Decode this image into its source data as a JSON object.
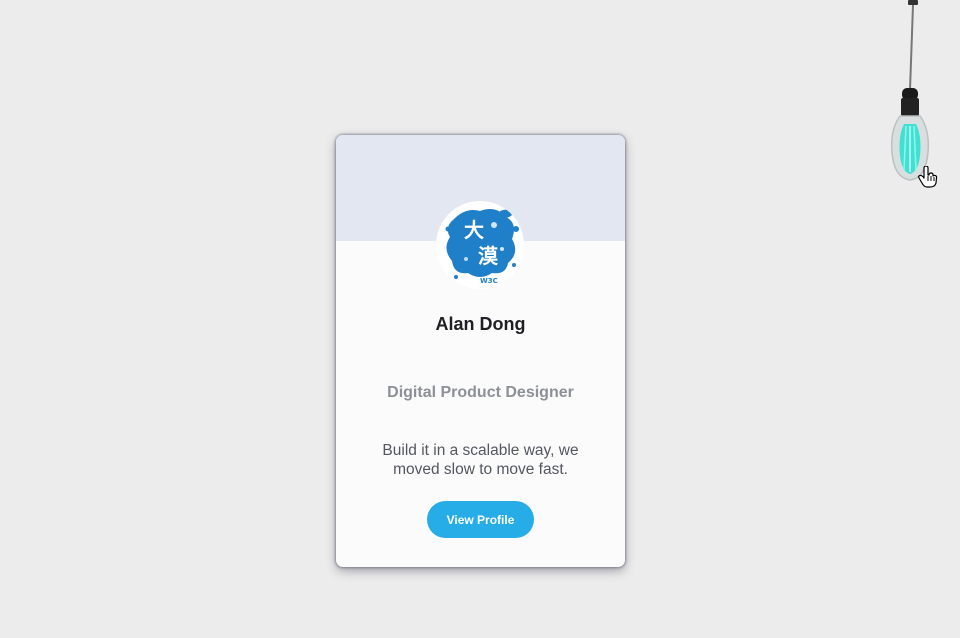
{
  "profile": {
    "name": "Alan Dong",
    "title": "Digital Product Designer",
    "bio_line1": "Build it in a scalable way, we",
    "bio_line2": "moved slow to move fast.",
    "button_label": "View Profile",
    "avatar_icon": "ink-splash-logo",
    "avatar_text_top": "大",
    "avatar_text_bottom": "漠",
    "avatar_caption": "W3C"
  },
  "lamp": {
    "icon": "hanging-lightbulb-icon",
    "cursor_icon": "hand-pointer-icon"
  },
  "colors": {
    "background": "#ececec",
    "card": "#fbfbfc",
    "banner": "#e3e7f1",
    "button": "#26ade8",
    "avatar_ink": "#1f7fc9",
    "bulb_glow": "#2fe0d0"
  }
}
